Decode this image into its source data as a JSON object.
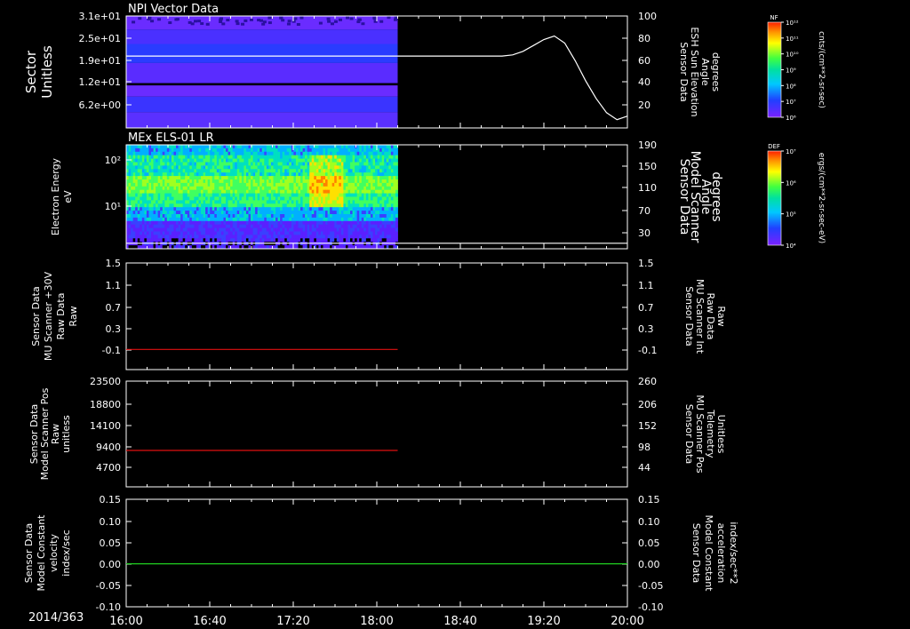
{
  "date_label": "2014/363",
  "time_ticks": [
    "16:00",
    "16:40",
    "17:20",
    "18:00",
    "18:40",
    "19:20",
    "20:00"
  ],
  "colors": {
    "red": "#e01010",
    "green": "#20d020",
    "white": "#ffffff"
  },
  "colorbars": [
    {
      "title": "NF",
      "unit": "cnts/(cm**2-sr-sec)",
      "ticks": [
        "10¹²",
        "10¹¹",
        "10¹⁰",
        "10⁹",
        "10⁸",
        "10⁷",
        "10⁶"
      ]
    },
    {
      "title": "DEF",
      "unit": "ergs/(cm**2-sr-sec-eV)",
      "ticks": [
        "10⁷",
        "10⁶",
        "10⁵",
        "10⁴"
      ]
    }
  ],
  "chart_data": [
    {
      "type": "heatmap",
      "title": "NPI Vector Data",
      "ylabel": [
        "Sector",
        "Unitless"
      ],
      "yticks": [
        "3.1e+01",
        "2.5e+01",
        "1.9e+01",
        "1.2e+01",
        "6.2e+00"
      ],
      "data_end_time": "18:10",
      "right_axis": {
        "label": [
          "Sensor Data",
          "ESH Sun Elevation",
          "Angle",
          "degrees"
        ],
        "ticks": [
          "100",
          "80",
          "60",
          "40",
          "20"
        ],
        "ylim": [
          5,
          100
        ],
        "line": {
          "color": "white",
          "x": [
            "16:00",
            "18:40",
            "19:00",
            "19:05",
            "19:10",
            "19:15",
            "19:20",
            "19:25",
            "19:30",
            "19:35",
            "19:40",
            "19:45",
            "19:50",
            "19:55",
            "20:00"
          ],
          "y": [
            66,
            66,
            66,
            67,
            70,
            75,
            80,
            83,
            77,
            62,
            45,
            30,
            18,
            12,
            15
          ]
        }
      }
    },
    {
      "type": "heatmap",
      "title": "MEx ELS-01 LR",
      "ylabel": [
        "Electron Energy",
        "eV"
      ],
      "yticks": [
        "10²",
        "10¹"
      ],
      "data_end_time": "18:10",
      "right_axis": {
        "label": [
          "Sensor Data",
          "Model Scanner",
          "Angle",
          "degrees"
        ],
        "ticks": [
          "190",
          "150",
          "110",
          "70",
          "30"
        ],
        "ylim": [
          0,
          190
        ],
        "line": {
          "color": "white",
          "x": [
            "16:00",
            "20:00"
          ],
          "y": [
            10,
            10
          ]
        }
      }
    },
    {
      "type": "line",
      "ylabel": [
        "Sensor Data",
        "MU Scanner +30V",
        "Raw Data",
        "Raw"
      ],
      "yticks": [
        "1.5",
        "1.1",
        "0.7",
        "0.3",
        "-0.1"
      ],
      "ylim": [
        -0.35,
        1.5
      ],
      "right_axis": {
        "label": [
          "Sensor Data",
          "MU Scanner Int",
          "Raw Data",
          "Raw"
        ],
        "ticks": [
          "1.5",
          "1.1",
          "0.7",
          "0.3",
          "-0.1"
        ]
      },
      "series": [
        {
          "color": "red",
          "x": [
            "16:00",
            "18:10"
          ],
          "y": [
            0.0,
            0.0
          ]
        }
      ]
    },
    {
      "type": "line",
      "ylabel": [
        "Sensor Data",
        "Model Scanner Pos",
        "Raw",
        "unitless"
      ],
      "yticks": [
        "23500",
        "18800",
        "14100",
        "9400",
        "4700"
      ],
      "ylim": [
        0,
        23500
      ],
      "right_axis": {
        "label": [
          "Sensor Data",
          "MU Scanner Pos",
          "Telemetry",
          "Unitless"
        ],
        "ticks": [
          "260",
          "206",
          "152",
          "98",
          "44"
        ]
      },
      "series": [
        {
          "color": "red",
          "x": [
            "16:00",
            "18:10"
          ],
          "y": [
            8100,
            8100
          ]
        }
      ]
    },
    {
      "type": "line",
      "ylabel": [
        "Sensor Data",
        "Model Constant",
        "velocity",
        "index/sec"
      ],
      "yticks": [
        "0.15",
        "0.10",
        "0.05",
        "0.00",
        "-0.05",
        "-0.10"
      ],
      "ylim": [
        -0.1,
        0.15
      ],
      "right_axis": {
        "label": [
          "Sensor Data",
          "Model Constant",
          "acceleration",
          "index/sec**2"
        ],
        "ticks": [
          "0.15",
          "0.10",
          "0.05",
          "0.00",
          "-0.05",
          "-0.10"
        ]
      },
      "series": [
        {
          "color": "green",
          "x": [
            "16:00",
            "20:00"
          ],
          "y": [
            0.0,
            0.0
          ]
        }
      ]
    }
  ]
}
